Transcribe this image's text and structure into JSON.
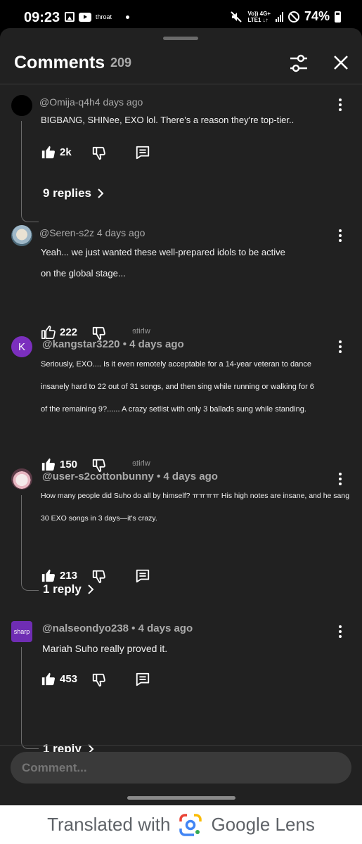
{
  "status_bar": {
    "time": "09:23",
    "app_text": "throat",
    "network_top": "Vo)) 4G+",
    "network_bottom": "LTE1 ↓↑",
    "battery": "74%"
  },
  "header": {
    "title": "Comments",
    "count": "209"
  },
  "comments": [
    {
      "author": "@Omija-q4h4 days ago",
      "lines": [
        "BIGBANG, SHINee, EXO lol. There's a reason they're top-tier.."
      ],
      "likes": "2k",
      "replies_label": "9 replies"
    },
    {
      "author": "@Seren-s2z 4 days ago",
      "lines": [
        "Yeah... we just wanted these well-prepared idols to be active",
        "on the global stage..."
      ],
      "likes": "222",
      "extra": "white"
    },
    {
      "avatar_letter": "K",
      "author": "@kangstar3220 • 4 days ago",
      "lines": [
        "Seriously, EXO.... Is it even remotely acceptable for a 14-year veteran to dance",
        "insanely hard to 22 out of 31 songs, and then sing while running or walking for 6",
        "of the remaining 9?...... A crazy setlist with only 3 ballads sung while standing."
      ],
      "likes": "150",
      "extra": "white"
    },
    {
      "author": "@user-s2cottonbunny • 4 days ago",
      "lines": [
        "How many people did Suho do all by himself? ㅠㅠㅠㅠ His high notes are insane, and he sang",
        "30 EXO songs in 3 days—it's crazy."
      ],
      "likes": "213",
      "replies_label": "1 reply"
    },
    {
      "avatar_text": "sharp",
      "author": "@nalseondyo238 • 4 days ago",
      "lines": [
        "Mariah Suho really proved it."
      ],
      "likes": "453",
      "replies_label": "1 reply"
    }
  ],
  "input": {
    "placeholder": "Comment..."
  },
  "banner": {
    "prefix": "Translated with",
    "brand": "Google Lens"
  },
  "colors": {
    "sheet_bg": "#212121",
    "avatar_k": "#7b2fbe",
    "avatar_sharp": "#6f2db3"
  }
}
